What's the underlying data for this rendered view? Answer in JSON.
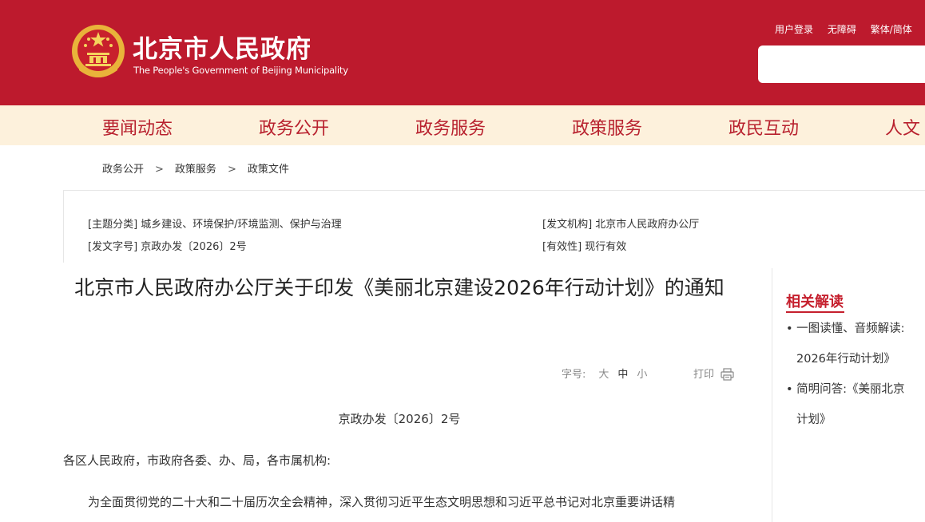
{
  "header": {
    "site_title": "北京市人民政府",
    "site_subtitle": "The People's Government of Beijing Municipality",
    "top_links": [
      "用户登录",
      "无障碍",
      "繁体/简体"
    ],
    "search_placeholder": "",
    "brand_color": "#bd1a2d"
  },
  "nav": {
    "items": [
      "要闻动态",
      "政务公开",
      "政务服务",
      "政策服务",
      "政民互动",
      "人文"
    ]
  },
  "breadcrumb": [
    "政务公开",
    "政策服务",
    "政策文件"
  ],
  "info": {
    "topic": "[主题分类] 城乡建设、环境保护/环境监测、保护与治理",
    "issuer": "[发文机构] 北京市人民政府办公厅",
    "doc_no": "[发文字号] 京政办发〔2026〕2号",
    "validity": "[有效性] 现行有效"
  },
  "article": {
    "title": "北京市人民政府办公厅关于印发《美丽北京建设2026年行动计划》的通知",
    "font_label": "字号:",
    "font_large": "大",
    "font_medium": "中",
    "font_small": "小",
    "print_label": "打印",
    "doc_number": "京政办发〔2026〕2号",
    "salutation": "各区人民政府，市政府各委、办、局，各市属机构:",
    "paragraph": "为全面贯彻党的二十大和二十届历次全会精神，深入贯彻习近平生态文明思想和习近平总书记对北京重要讲话精"
  },
  "sidebar": {
    "title": "相关解读",
    "items": [
      {
        "line1": "• 一图读懂、音频解读:",
        "line2": "2026年行动计划》"
      },
      {
        "line1": "• 简明问答:《美丽北京",
        "line2": "计划》"
      }
    ],
    "accent_color": "#c51f2d"
  }
}
